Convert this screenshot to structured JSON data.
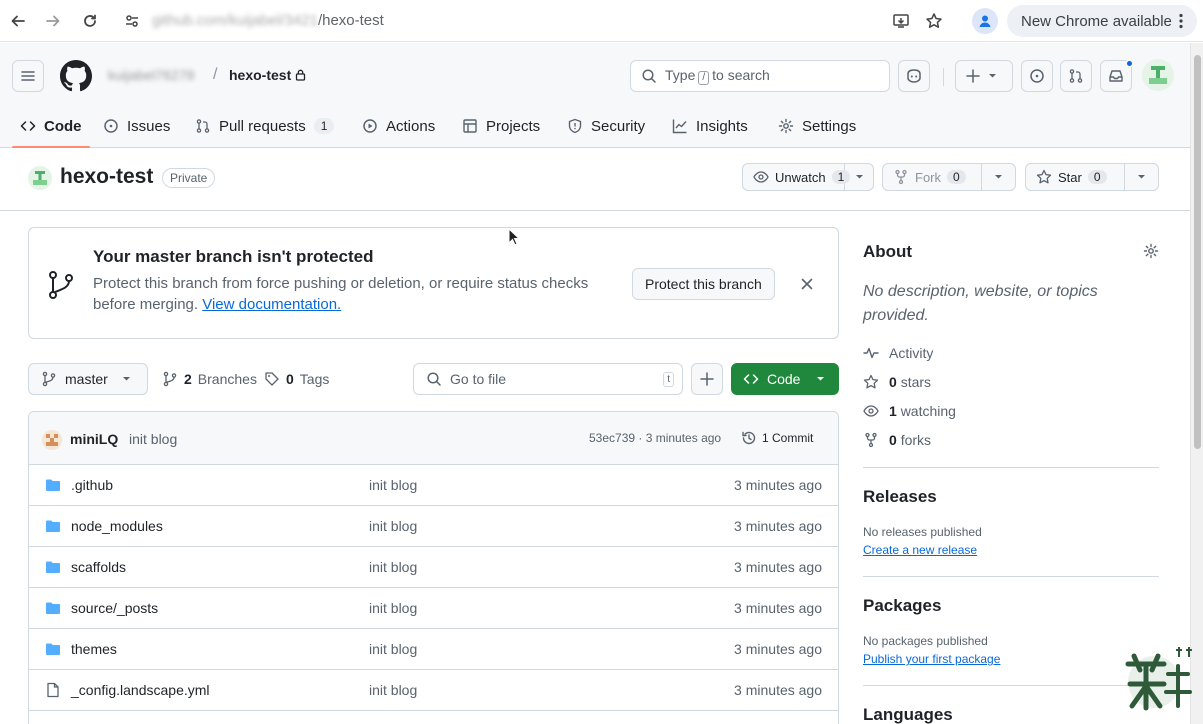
{
  "browser": {
    "url_blurred": "github.com/kuijabel/3421",
    "url_visible": "/hexo-test",
    "update_label": "New Chrome available"
  },
  "header": {
    "owner_blurred": "kuijabel76278",
    "repo": "hexo-test",
    "search_prefix": "Type",
    "search_key": "/",
    "search_suffix": "to search"
  },
  "tabs": [
    {
      "label": "Code",
      "icon": "code-icon",
      "active": true
    },
    {
      "label": "Issues",
      "icon": "issue-opened-icon"
    },
    {
      "label": "Pull requests",
      "icon": "git-pull-request-icon",
      "count": "1"
    },
    {
      "label": "Actions",
      "icon": "play-icon"
    },
    {
      "label": "Projects",
      "icon": "table-icon"
    },
    {
      "label": "Security",
      "icon": "shield-icon"
    },
    {
      "label": "Insights",
      "icon": "graph-icon"
    },
    {
      "label": "Settings",
      "icon": "gear-icon"
    }
  ],
  "repo_title": {
    "name": "hexo-test",
    "visibility": "Private",
    "unwatch_label": "Unwatch",
    "unwatch_count": "1",
    "fork_label": "Fork",
    "fork_count": "0",
    "star_label": "Star",
    "star_count": "0"
  },
  "banner": {
    "title": "Your master branch isn't protected",
    "text": "Protect this branch from force pushing or deletion, or require status checks before merging.",
    "link": "View documentation.",
    "button": "Protect this branch"
  },
  "toolbar": {
    "branch": "master",
    "branches_count": "2",
    "branches_label": "Branches",
    "tags_count": "0",
    "tags_label": "Tags",
    "goto_placeholder": "Go to file",
    "goto_key": "t",
    "code_label": "Code"
  },
  "commit": {
    "author": "miniLQ",
    "message": "init blog",
    "hash_time": "53ec739 · 3 minutes ago",
    "count_label": "1 Commit"
  },
  "files": [
    {
      "name": ".github",
      "type": "folder",
      "message": "init blog",
      "time": "3 minutes ago"
    },
    {
      "name": "node_modules",
      "type": "folder",
      "message": "init blog",
      "time": "3 minutes ago"
    },
    {
      "name": "scaffolds",
      "type": "folder",
      "message": "init blog",
      "time": "3 minutes ago"
    },
    {
      "name": "source/_posts",
      "type": "folder",
      "message": "init blog",
      "time": "3 minutes ago"
    },
    {
      "name": "themes",
      "type": "folder",
      "message": "init blog",
      "time": "3 minutes ago"
    },
    {
      "name": "_config.landscape.yml",
      "type": "file",
      "message": "init blog",
      "time": "3 minutes ago"
    }
  ],
  "sidebar": {
    "about_title": "About",
    "about_desc": "No description, website, or topics provided.",
    "activity": "Activity",
    "stars_count": "0",
    "stars_label": "stars",
    "watching_count": "1",
    "watching_label": "watching",
    "forks_count": "0",
    "forks_label": "forks",
    "releases_title": "Releases",
    "releases_note": "No releases published",
    "releases_link": "Create a new release",
    "packages_title": "Packages",
    "packages_note": "No packages published",
    "packages_link": "Publish your first package",
    "languages_title": "Languages"
  },
  "colors": {
    "accent_green": "#1f883d",
    "link_blue": "#0969da",
    "tab_underline": "#fd8c73",
    "folder_blue": "#54aeff"
  }
}
